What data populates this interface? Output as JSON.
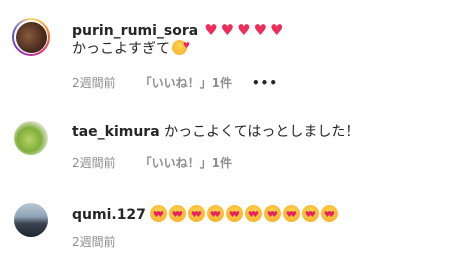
{
  "comments": [
    {
      "username": "purin_rumi_sora",
      "text": "かっこよすぎて",
      "emoji_icons": [
        "heart-icon",
        "heart-icon",
        "heart-icon",
        "heart-icon",
        "heart-icon"
      ],
      "time": "2週間前",
      "likes": "「いいね！」1件",
      "more": "•••"
    },
    {
      "username": "tae_kimura",
      "text": "かっこよくてはっとしました！",
      "time": "2週間前",
      "likes": "「いいね！」1件"
    },
    {
      "username": "qumi.127",
      "emoji_icons": [
        "star-eyes-icon",
        "star-eyes-icon",
        "star-eyes-icon",
        "star-eyes-icon",
        "star-eyes-icon",
        "star-eyes-icon",
        "star-eyes-icon",
        "star-eyes-icon",
        "star-eyes-icon",
        "star-eyes-icon"
      ],
      "time": "2週間前"
    }
  ],
  "colors": {
    "heart": "#ed2e5a",
    "meta": "#8e8e8e",
    "text": "#262626"
  }
}
